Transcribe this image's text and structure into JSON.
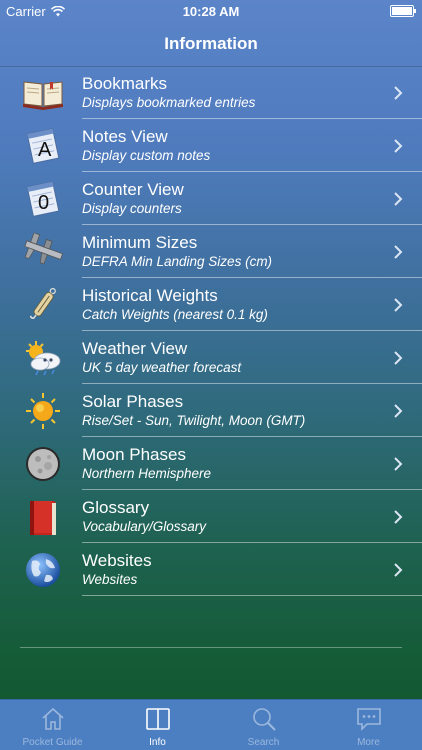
{
  "status": {
    "carrier": "Carrier",
    "time": "10:28 AM"
  },
  "navbar": {
    "title": "Information"
  },
  "list": [
    {
      "title": "Bookmarks",
      "subtitle": "Displays bookmarked entries",
      "icon": "book-icon"
    },
    {
      "title": "Notes View",
      "subtitle": "Display custom notes",
      "icon": "notes-icon"
    },
    {
      "title": "Counter View",
      "subtitle": "Display counters",
      "icon": "counter-icon"
    },
    {
      "title": "Minimum Sizes",
      "subtitle": "DEFRA Min Landing Sizes (cm)",
      "icon": "caliper-icon"
    },
    {
      "title": "Historical Weights",
      "subtitle": "Catch Weights (nearest 0.1 kg)",
      "icon": "scale-icon"
    },
    {
      "title": "Weather View",
      "subtitle": "UK 5 day weather forecast",
      "icon": "weather-icon"
    },
    {
      "title": "Solar Phases",
      "subtitle": "Rise/Set - Sun, Twilight, Moon (GMT)",
      "icon": "sun-icon"
    },
    {
      "title": "Moon Phases",
      "subtitle": "Northern Hemisphere",
      "icon": "moon-icon"
    },
    {
      "title": "Glossary",
      "subtitle": "Vocabulary/Glossary",
      "icon": "glossary-icon"
    },
    {
      "title": "Websites",
      "subtitle": "Websites",
      "icon": "globe-icon"
    }
  ],
  "notes_icon_letter": "A",
  "counter_icon_digit": "0",
  "tabs": [
    {
      "label": "Pocket Guide",
      "icon": "home-icon",
      "active": false
    },
    {
      "label": "Info",
      "icon": "book-open-icon",
      "active": true
    },
    {
      "label": "Search",
      "icon": "search-icon",
      "active": false
    },
    {
      "label": "More",
      "icon": "more-icon",
      "active": false
    }
  ],
  "colors": {
    "tab_active": "#ffffff",
    "tab_inactive": "#9cb7dd",
    "tabbar_bg": "#4b7fc2"
  }
}
